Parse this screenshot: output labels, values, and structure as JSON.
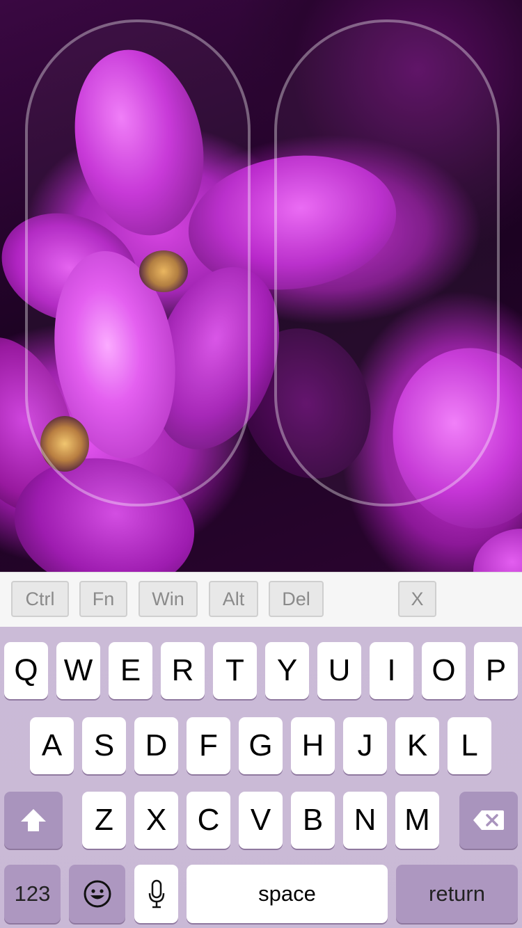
{
  "modifiers": {
    "ctrl": "Ctrl",
    "fn": "Fn",
    "win": "Win",
    "alt": "Alt",
    "del": "Del",
    "close": "X"
  },
  "keyboard": {
    "row1": [
      "Q",
      "W",
      "E",
      "R",
      "T",
      "Y",
      "U",
      "I",
      "O",
      "P"
    ],
    "row2": [
      "A",
      "S",
      "D",
      "F",
      "G",
      "H",
      "J",
      "K",
      "L"
    ],
    "row3": [
      "Z",
      "X",
      "C",
      "V",
      "B",
      "N",
      "M"
    ],
    "numbers_label": "123",
    "space_label": "space",
    "return_label": "return",
    "shift_icon": "shift-arrow-icon",
    "delete_icon": "backspace-icon",
    "emoji_icon": "smiley-icon",
    "mic_icon": "microphone-icon"
  },
  "colors": {
    "keyboard_bg": "#cbbbd7",
    "function_key": "#a994bd",
    "letter_key": "#ffffff"
  }
}
